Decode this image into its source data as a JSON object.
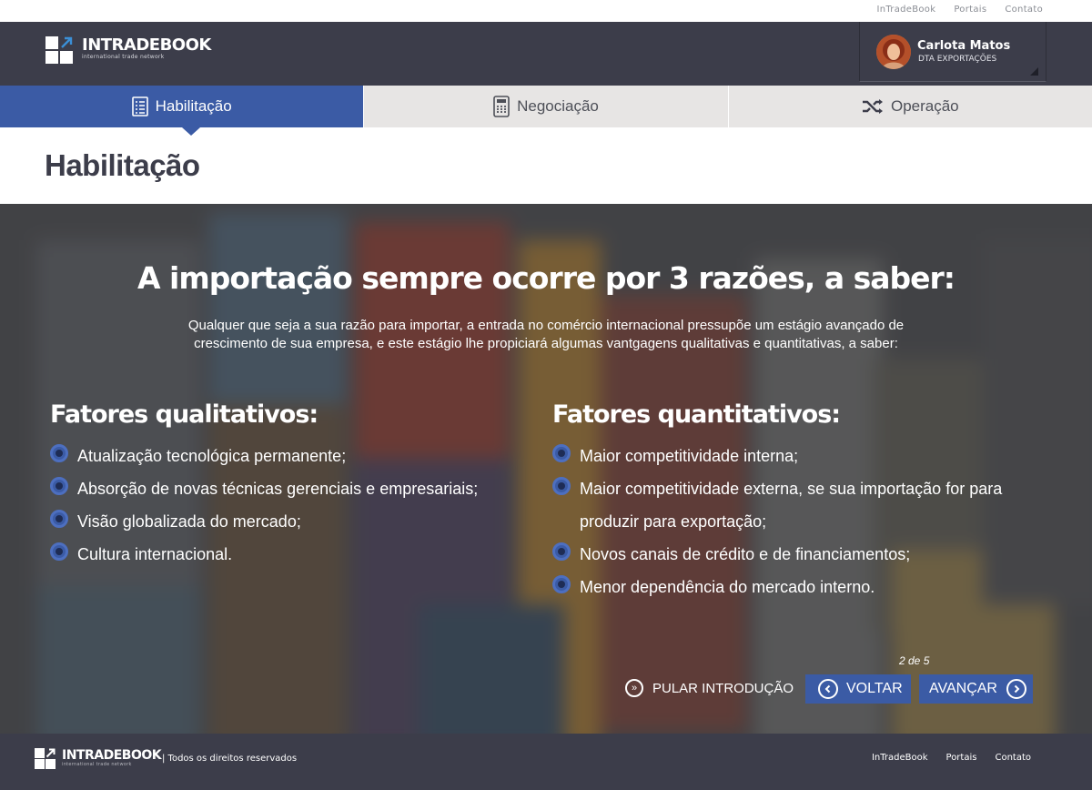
{
  "util_links": [
    "InTradeBook",
    "Portais",
    "Contato"
  ],
  "brand": {
    "name": "INTRADEBOOK",
    "tagline": "international trade network"
  },
  "user": {
    "name": "Carlota Matos",
    "role": "DTA EXPORTAÇÕES"
  },
  "tabs": [
    {
      "label": "Habilitação",
      "icon": "checklist-icon",
      "active": true
    },
    {
      "label": "Negociação",
      "icon": "calculator-icon",
      "active": false
    },
    {
      "label": "Operação",
      "icon": "shuffle-icon",
      "active": false
    }
  ],
  "page_title": "Habilitação",
  "hero": {
    "title": "A importação sempre ocorre por 3 razões, a saber:",
    "intro": "Qualquer que seja a sua razão para importar, a entrada no comércio internacional pressupõe um estágio avançado de crescimento de sua empresa, e este estágio lhe propiciará algumas vantgagens qualitativas e quantitativas, a saber:",
    "qualitative": {
      "title": "Fatores qualitativos:",
      "items": [
        "Atualização tecnológica permanente;",
        "Absorção de novas técnicas gerenciais e empresariais;",
        "Visão globalizada do mercado;",
        "Cultura internacional."
      ]
    },
    "quantitative": {
      "title": "Fatores quantitativos:",
      "items": [
        "Maior competitividade interna;",
        "Maior competitividade externa, se sua importação for para produzir para exportação;",
        "Novos canais de crédito e de financiamentos;",
        "Menor dependência do mercado interno."
      ]
    },
    "pager": "2 de 5",
    "skip_label": "PULAR INTRODUÇÃO",
    "back_label": "VOLTAR",
    "next_label": "AVANÇAR"
  },
  "footer": {
    "brand": "INTRADEBOOK",
    "tagline": "international trade network",
    "copyright": "| Todos os direitos reservados",
    "links": [
      "InTradeBook",
      "Portais",
      "Contato"
    ]
  },
  "colors": {
    "header": "#3c3d4a",
    "accent": "#3b5ba5",
    "tab_inactive": "#e7e5e4"
  }
}
